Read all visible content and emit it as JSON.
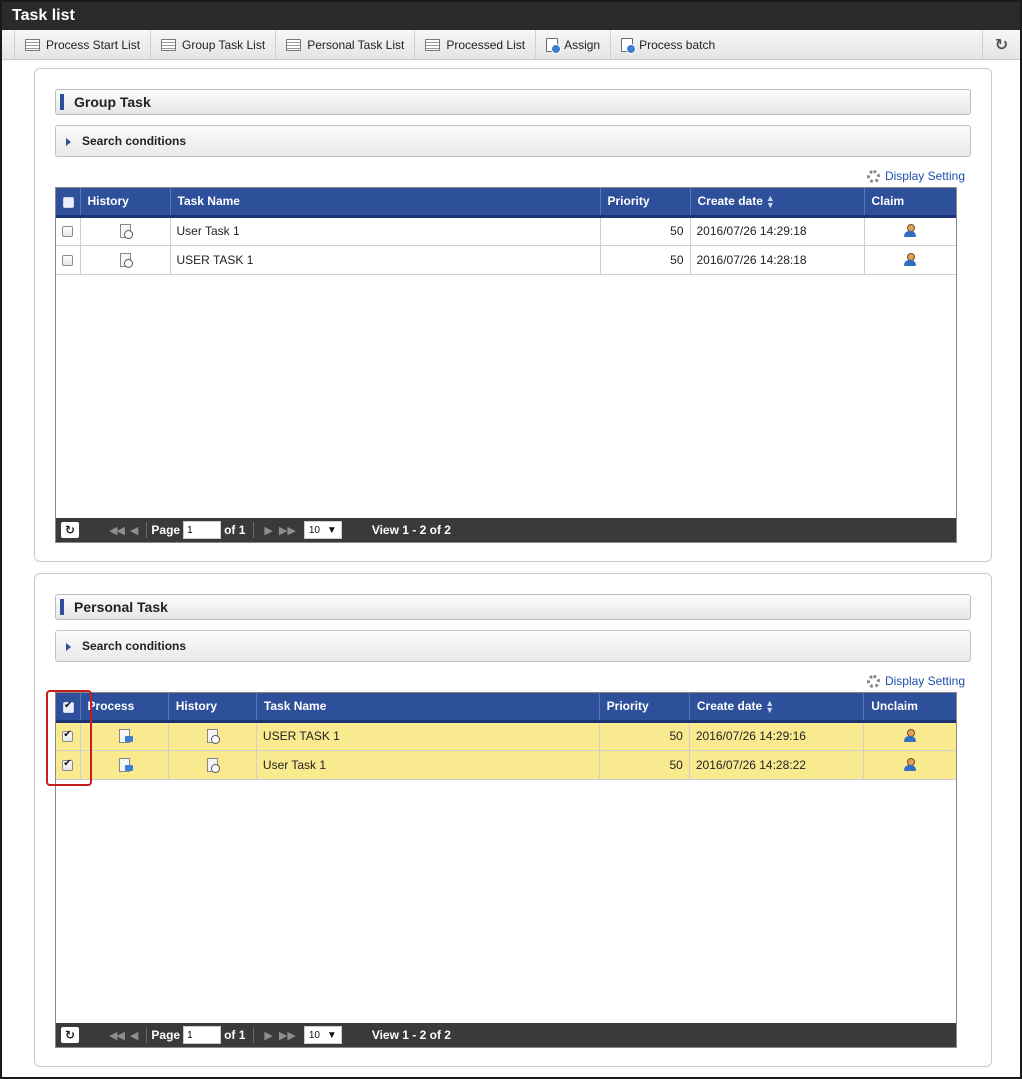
{
  "window": {
    "title": "Task list"
  },
  "toolbar": {
    "buttons": [
      {
        "label": "Process Start List",
        "icon": "list-icon"
      },
      {
        "label": "Group Task List",
        "icon": "list-icon"
      },
      {
        "label": "Personal Task List",
        "icon": "list-icon"
      },
      {
        "label": "Processed List",
        "icon": "list-icon"
      },
      {
        "label": "Assign",
        "icon": "assign-icon"
      },
      {
        "label": "Process batch",
        "icon": "process-batch-icon"
      }
    ],
    "refresh_icon": "refresh-icon"
  },
  "group_task": {
    "title": "Group Task",
    "search_label": "Search conditions",
    "display_setting": "Display Setting",
    "columns": [
      "History",
      "Task Name",
      "Priority",
      "Create date",
      "Claim"
    ],
    "rows": [
      {
        "task_name": "User Task 1",
        "priority": "50",
        "create_date": "2016/07/26 14:29:18",
        "checked": false
      },
      {
        "task_name": "USER TASK 1",
        "priority": "50",
        "create_date": "2016/07/26 14:28:18",
        "checked": false
      }
    ],
    "pager": {
      "page_label": "Page",
      "page_value": "1",
      "of_label": "of 1",
      "page_size": "10",
      "view_text": "View 1 - 2 of 2"
    }
  },
  "personal_task": {
    "title": "Personal Task",
    "search_label": "Search conditions",
    "display_setting": "Display Setting",
    "columns": [
      "Process",
      "History",
      "Task Name",
      "Priority",
      "Create date",
      "Unclaim"
    ],
    "rows": [
      {
        "task_name": "USER TASK 1",
        "priority": "50",
        "create_date": "2016/07/26 14:29:16",
        "checked": true
      },
      {
        "task_name": "User Task 1",
        "priority": "50",
        "create_date": "2016/07/26 14:28:22",
        "checked": true
      }
    ],
    "pager": {
      "page_label": "Page",
      "page_value": "1",
      "of_label": "of 1",
      "page_size": "10",
      "view_text": "View 1 - 2 of 2"
    }
  },
  "colors": {
    "header_blue": "#2e4f9a",
    "selected_row": "#f9ea8f",
    "highlight": "#c81e1e",
    "pager_bg": "#3a3a3a"
  }
}
